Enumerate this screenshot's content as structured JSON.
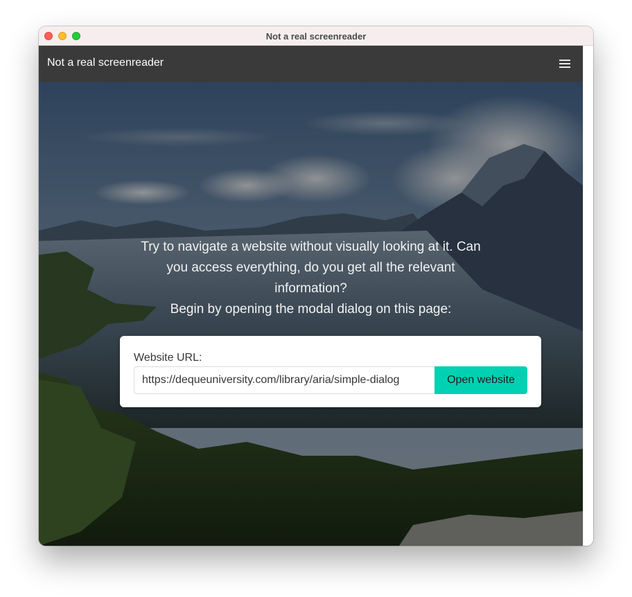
{
  "window": {
    "title": "Not a real screenreader"
  },
  "navbar": {
    "brand": "Not a real screenreader",
    "menu_icon": "hamburger-menu-icon"
  },
  "hero": {
    "background": "mountain-lake-landscape-photo",
    "intro": "Try to navigate a website without visually looking at it. Can you access everything, do you get all the relevant information?",
    "instruction": "Begin by opening the modal dialog on this page:"
  },
  "form": {
    "label": "Website URL:",
    "url_value": "https://dequeuniversity.com/library/aria/simple-dialog",
    "button_label": "Open website"
  },
  "colors": {
    "navbar": "#3a3a3a",
    "button": "#00d1b2",
    "title_bar": "#f6eeee"
  }
}
